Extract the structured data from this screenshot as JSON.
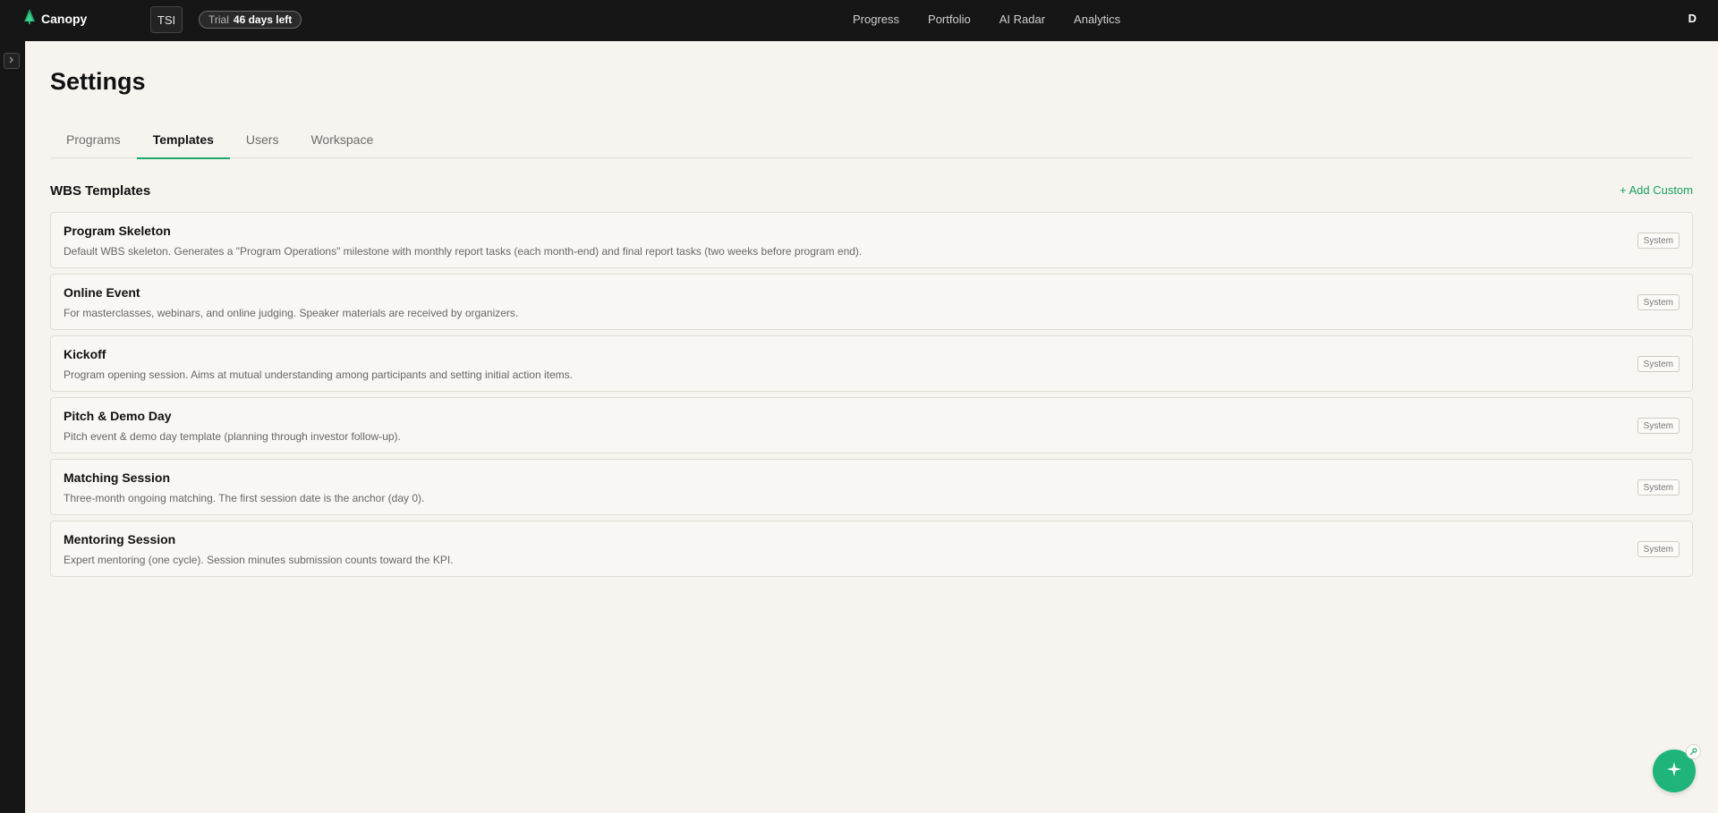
{
  "app": {
    "brand": "Canopy",
    "brand_color": "#1fa86a",
    "org": "TSI",
    "trial": {
      "label": "Trial",
      "days_left": "46 days left"
    },
    "avatar_initial": "D"
  },
  "nav": {
    "items": [
      {
        "label": "Progress"
      },
      {
        "label": "Portfolio"
      },
      {
        "label": "AI Radar"
      },
      {
        "label": "Analytics"
      }
    ]
  },
  "page": {
    "title": "Settings",
    "tabs": [
      {
        "label": "Programs",
        "active": false
      },
      {
        "label": "Templates",
        "active": true
      },
      {
        "label": "Users",
        "active": false
      },
      {
        "label": "Workspace",
        "active": false
      }
    ]
  },
  "templates": {
    "section_title": "WBS Templates",
    "add_label": "+ Add Custom",
    "items": [
      {
        "name": "Program Skeleton",
        "description": "Default WBS skeleton. Generates a \"Program Operations\" milestone with monthly report tasks (each month-end) and final report tasks (two weeks before program end).",
        "badge": "System"
      },
      {
        "name": "Online Event",
        "description": "For masterclasses, webinars, and online judging. Speaker materials are received by organizers.",
        "badge": "System"
      },
      {
        "name": "Kickoff",
        "description": "Program opening session. Aims at mutual understanding among participants and setting initial action items.",
        "badge": "System"
      },
      {
        "name": "Pitch & Demo Day",
        "description": "Pitch event & demo day template (planning through investor follow-up).",
        "badge": "System"
      },
      {
        "name": "Matching Session",
        "description": "Three-month ongoing matching. The first session date is the anchor (day 0).",
        "badge": "System"
      },
      {
        "name": "Mentoring Session",
        "description": "Expert mentoring (one cycle). Session minutes submission counts toward the KPI.",
        "badge": "System"
      }
    ]
  },
  "icons": {
    "brand": "tree-logo-icon",
    "rail_toggle": "chevron-right-icon",
    "fab": "sparkle-icon",
    "fab_mini": "pin-icon"
  }
}
